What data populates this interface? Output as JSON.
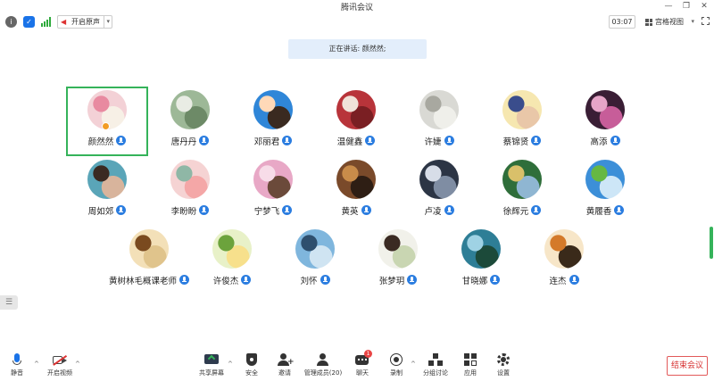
{
  "window": {
    "title": "腾讯会议",
    "minimize": "—",
    "restore": "❐",
    "close": "✕"
  },
  "topbar": {
    "mute_all_label": "开启原声",
    "timer": "03:07",
    "view_label": "宫格视图"
  },
  "speaking_banner": "正在讲话: 颜然然;",
  "participants": [
    {
      "name": "颜然然",
      "host": true,
      "active": true,
      "colors": [
        "#f3d1d6",
        "#e88aa0",
        "#f7f0e6"
      ]
    },
    {
      "name": "唐丹丹",
      "colors": [
        "#9db897",
        "#e9ece4",
        "#6d8a67"
      ]
    },
    {
      "name": "邓丽君",
      "colors": [
        "#2f86d8",
        "#ffd9b8",
        "#3a2a20"
      ]
    },
    {
      "name": "温健鑫",
      "colors": [
        "#b8343a",
        "#f0e2d8",
        "#7a1f23"
      ]
    },
    {
      "name": "许婕",
      "colors": [
        "#d9d9d4",
        "#a8a8a0",
        "#efefea"
      ]
    },
    {
      "name": "蔡锦贤",
      "colors": [
        "#f6e7b0",
        "#3a4d8c",
        "#e9c7a8"
      ]
    },
    {
      "name": "高添",
      "colors": [
        "#3a1e35",
        "#e6a5c8",
        "#c75d99"
      ]
    },
    {
      "name": "周如郊",
      "colors": [
        "#5aa5b8",
        "#3a2a22",
        "#d8b49c"
      ]
    },
    {
      "name": "李盼盼",
      "colors": [
        "#f5d3d3",
        "#8fb7a6",
        "#f4a7a7"
      ]
    },
    {
      "name": "宁梦飞",
      "colors": [
        "#e8a8c6",
        "#f7dce8",
        "#6b4a3a"
      ]
    },
    {
      "name": "黄英",
      "colors": [
        "#7a4a2a",
        "#c98c4a",
        "#2e1e14"
      ]
    },
    {
      "name": "卢凌",
      "colors": [
        "#2c3545",
        "#d7dde8",
        "#7f8da3"
      ]
    },
    {
      "name": "徐辉元",
      "colors": [
        "#2f6e3a",
        "#d9c06a",
        "#8fb6d2"
      ]
    },
    {
      "name": "黄履香",
      "colors": [
        "#3c8fd8",
        "#66b843",
        "#cde6f7"
      ]
    },
    {
      "name": "黄树林毛概课老师",
      "colors": [
        "#f3e0b8",
        "#7a4a1f",
        "#e0c48c"
      ]
    },
    {
      "name": "许俊杰",
      "colors": [
        "#e8f1c8",
        "#6ca33c",
        "#f7e08c"
      ]
    },
    {
      "name": "刘怀",
      "colors": [
        "#7fb6dd",
        "#2e4f6e",
        "#cfe4f2"
      ]
    },
    {
      "name": "张梦玥",
      "colors": [
        "#f1f1ea",
        "#3a2a22",
        "#c9d6b2"
      ]
    },
    {
      "name": "甘晓娜",
      "colors": [
        "#2e7e96",
        "#9fd2e4",
        "#1c4a3a"
      ]
    },
    {
      "name": "连杰",
      "colors": [
        "#f7e6c8",
        "#d47a2a",
        "#3a2a1a"
      ]
    }
  ],
  "bottombar": {
    "tools": [
      {
        "key": "mute",
        "label": "静音"
      },
      {
        "key": "video",
        "label": "开启视频"
      },
      {
        "key": "share",
        "label": "共享屏幕"
      },
      {
        "key": "security",
        "label": "安全"
      },
      {
        "key": "invite",
        "label": "邀请"
      },
      {
        "key": "members",
        "label": "管理成员(20)"
      },
      {
        "key": "chat",
        "label": "聊天",
        "badge": "1"
      },
      {
        "key": "record",
        "label": "录制"
      },
      {
        "key": "breakout",
        "label": "分组讨论"
      },
      {
        "key": "apps",
        "label": "应用"
      },
      {
        "key": "settings",
        "label": "设置"
      }
    ],
    "end_label": "结束会议"
  },
  "theme": {
    "accent_green": "#35b35a",
    "mic_blue": "#2b7de0",
    "end_red": "#d63030"
  }
}
